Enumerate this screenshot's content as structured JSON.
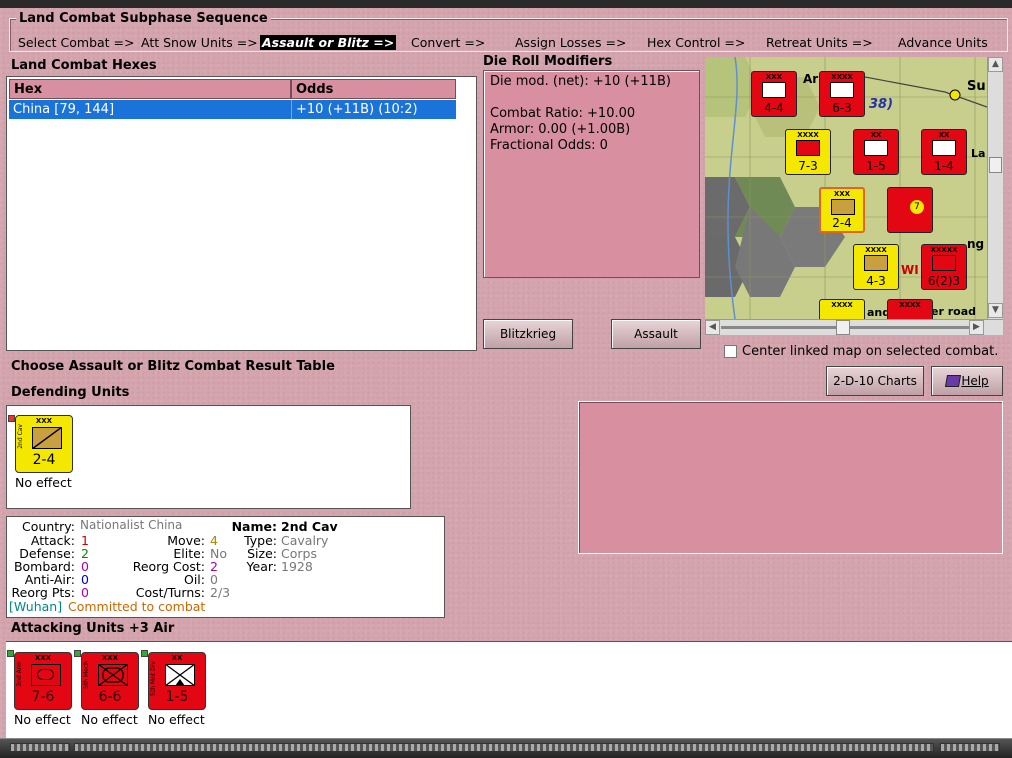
{
  "sequence": {
    "title": "Land Combat Subphase Sequence",
    "steps": [
      "Select Combat =>",
      "Att Snow Units =>",
      "Assault or Blitz =>",
      "Convert =>",
      "Assign Losses =>",
      "Hex Control =>",
      "Retreat Units =>",
      "Advance Units"
    ],
    "active_index": 2
  },
  "hexes": {
    "title": "Land Combat Hexes",
    "columns": [
      "Hex",
      "Odds"
    ],
    "rows": [
      {
        "hex": "China [79, 144]",
        "odds": "+10 (+11B) (10:2)"
      }
    ]
  },
  "die_roll": {
    "title": "Die Roll Modifiers",
    "lines": [
      "Die mod. (net): +10 (+11B)",
      "",
      "Combat Ratio: +10.00",
      "Armor: 0.00 (+1.00B)",
      "Fractional Odds: 0"
    ]
  },
  "buttons": {
    "blitzkrieg": "Blitzkrieg",
    "assault": "Assault",
    "charts": "2-D-10 Charts",
    "help": "Help"
  },
  "center_map_label": "Center linked map on selected combat.",
  "choose_label": "Choose Assault or Blitz Combat Result Table",
  "defending": {
    "title": "Defending Units",
    "units": [
      {
        "size": "XXX",
        "name": "2nd Cav",
        "value": "2-4",
        "result": "No effect",
        "color": "#f5e800"
      }
    ]
  },
  "info": {
    "country_label": "Country:",
    "country": "Nationalist China",
    "attack_label": "Attack:",
    "attack": "1",
    "defense_label": "Defense:",
    "defense": "2",
    "bombard_label": "Bombard:",
    "bombard": "0",
    "antiair_label": "Anti-Air:",
    "antiair": "0",
    "reorg_label": "Reorg Pts:",
    "reorg": "0",
    "move_label": "Move:",
    "move": "4",
    "elite_label": "Elite:",
    "elite": "No",
    "reorg_cost_label": "Reorg Cost:",
    "reorg_cost": "2",
    "oil_label": "Oil:",
    "oil": "0",
    "cost_label": "Cost/Turns:",
    "cost": "2/3",
    "name_label": "Name:",
    "name": "2nd Cav",
    "type_label": "Type:",
    "type": "Cavalry",
    "size_label": "Size:",
    "size": "Corps",
    "year_label": "Year:",
    "year": "1928",
    "location": "[Wuhan]",
    "status": "Committed to combat"
  },
  "attacking": {
    "title": "Attacking Units +3 Air",
    "units": [
      {
        "size": "XXX",
        "name": "2nd Arm",
        "value": "7-6",
        "result": "No effect",
        "color": "#e30613"
      },
      {
        "size": "XXX",
        "name": "5th Mech",
        "value": "6-6",
        "result": "No effect",
        "color": "#e30613"
      },
      {
        "size": "XX",
        "name": "5th Mnt Div",
        "value": "1-5",
        "result": "No effect",
        "color": "#e30613"
      }
    ]
  },
  "map": {
    "labels": [
      "Su",
      "La",
      "ng",
      "38)",
      "Ar",
      "WI",
      "and",
      "er road"
    ],
    "counters": [
      {
        "size": "XXX",
        "value": "4-4",
        "color": "#e30613"
      },
      {
        "size": "XXXX",
        "value": "6-3",
        "color": "#e30613"
      },
      {
        "size": "XXXX",
        "value": "7-3",
        "color": "#f5e800"
      },
      {
        "size": "XX",
        "value": "1-5",
        "color": "#e30613"
      },
      {
        "size": "XX",
        "value": "1-4",
        "color": "#e30613"
      },
      {
        "size": "XXX",
        "value": "2-4",
        "color": "#f5e800"
      },
      {
        "size": "",
        "value": "7",
        "color": "#e30613"
      },
      {
        "size": "XXXX",
        "value": "4-3",
        "color": "#f5e800"
      },
      {
        "size": "XXXXX",
        "value": "6(2)3",
        "color": "#e30613"
      },
      {
        "size": "XXXX",
        "value": "",
        "color": "#f5e800"
      },
      {
        "size": "XXXX",
        "value": "",
        "color": "#e30613"
      }
    ]
  },
  "colors": {
    "panel": "#d4a5ae",
    "header": "#d88fa0",
    "selection": "#1a73d9",
    "attack": "#cc0000",
    "defense": "#008800",
    "bombard": "#aa00aa",
    "antiair": "#0000cc",
    "move": "#aa8800",
    "location": "#008888",
    "status": "#cc6600"
  }
}
